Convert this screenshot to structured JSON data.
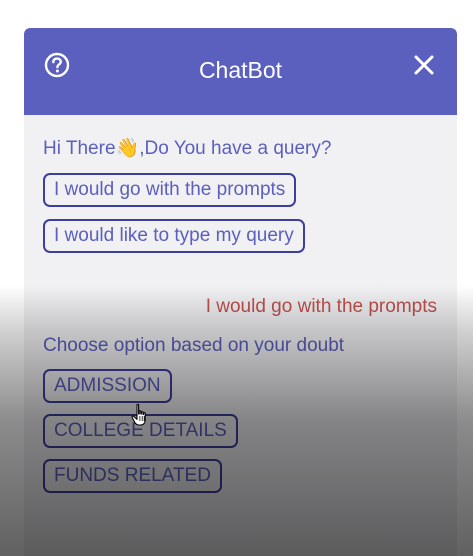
{
  "header": {
    "title": "ChatBot",
    "help_icon": "question-circle-icon",
    "close_icon": "close-icon"
  },
  "messages": {
    "greeting_prefix": "Hi There",
    "greeting_emoji": "👋",
    "greeting_suffix": ",Do You have a query?",
    "prompt_option_1": "I would go with the prompts",
    "prompt_option_2": "I would like to type my query",
    "user_reply": "I would go with the prompts",
    "choose_text": "Choose option based on your doubt",
    "doubt_options": [
      "ADMISSION",
      "COLLEGE DETAILS",
      "FUNDS RELATED"
    ]
  },
  "colors": {
    "header_bg": "#5b5fbd",
    "bot_text": "#5b5fbd",
    "user_text": "#c0504d",
    "button_border": "#3d3f9c",
    "body_bg": "#f1f1f4"
  }
}
